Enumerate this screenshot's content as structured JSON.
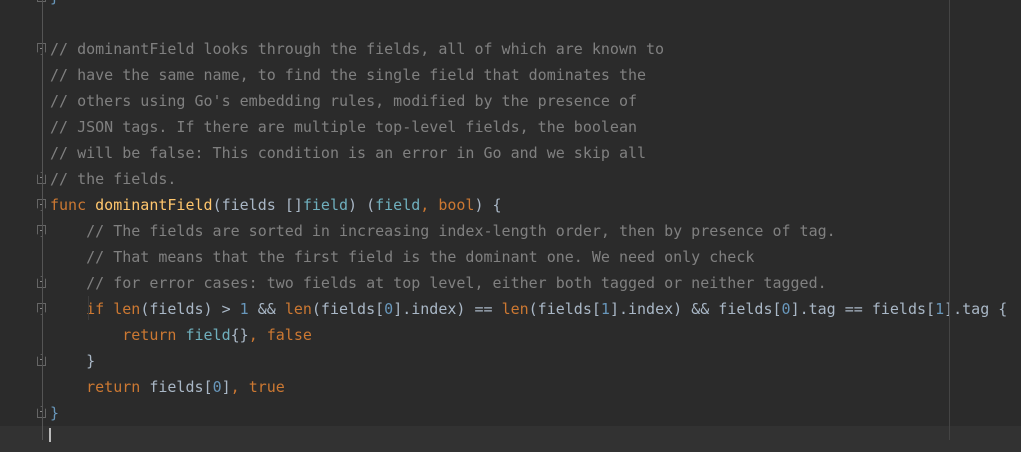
{
  "colors": {
    "background": "#2b2b2b",
    "comment": "#808080",
    "keyword": "#cc7832",
    "function": "#ffc66d",
    "type": "#6fafbd",
    "identifier": "#a9b7c6",
    "number": "#6897bb"
  },
  "lines": [
    {
      "fold": "end",
      "tokens": [
        [
          "}",
          "bb"
        ]
      ]
    },
    {
      "fold": "",
      "tokens": []
    },
    {
      "fold": "start",
      "tokens": [
        [
          "// dominantField looks through the fields, all of which are known to",
          "cm"
        ]
      ]
    },
    {
      "fold": "",
      "tokens": [
        [
          "// have the same name, to find the single field that dominates the",
          "cm"
        ]
      ]
    },
    {
      "fold": "",
      "tokens": [
        [
          "// others using Go's embedding rules, modified by the presence of",
          "cm"
        ]
      ]
    },
    {
      "fold": "",
      "tokens": [
        [
          "// JSON tags. If there are multiple top-level fields, the boolean",
          "cm"
        ]
      ]
    },
    {
      "fold": "",
      "tokens": [
        [
          "// will be false: This condition is an error in Go and we skip all",
          "cm"
        ]
      ]
    },
    {
      "fold": "end",
      "tokens": [
        [
          "// the fields.",
          "cm"
        ]
      ]
    },
    {
      "fold": "start",
      "tokens": [
        [
          "func ",
          "kw"
        ],
        [
          "dominantField",
          "fn"
        ],
        [
          "(fields ",
          "id"
        ],
        [
          "[]",
          "id"
        ],
        [
          "field",
          "ty"
        ],
        [
          ") (",
          "id"
        ],
        [
          "field",
          "ty"
        ],
        [
          ", ",
          "kw"
        ],
        [
          "bool",
          "kw"
        ],
        [
          ") {",
          "id"
        ]
      ]
    },
    {
      "fold": "start",
      "tokens": [
        [
          "    // The fields are sorted in increasing index-length order, then by presence of tag.",
          "cm"
        ]
      ]
    },
    {
      "fold": "",
      "tokens": [
        [
          "    // That means that the first field is the dominant one. We need only check",
          "cm"
        ]
      ]
    },
    {
      "fold": "end",
      "tokens": [
        [
          "    // for error cases: two fields at top level, either both tagged or neither tagged.",
          "cm"
        ]
      ]
    },
    {
      "fold": "start",
      "tokens": [
        [
          "    if ",
          "kw"
        ],
        [
          "len",
          "kw"
        ],
        [
          "(fields) > ",
          "id"
        ],
        [
          "1",
          "num"
        ],
        [
          " && ",
          "id"
        ],
        [
          "len",
          "kw"
        ],
        [
          "(fields[",
          "id"
        ],
        [
          "0",
          "num"
        ],
        [
          "].index) == ",
          "id"
        ],
        [
          "len",
          "kw"
        ],
        [
          "(fields[",
          "id"
        ],
        [
          "1",
          "num"
        ],
        [
          "].index) && fields[",
          "id"
        ],
        [
          "0",
          "num"
        ],
        [
          "].tag == fields[",
          "id"
        ],
        [
          "1",
          "num"
        ],
        [
          "].tag {",
          "id"
        ]
      ]
    },
    {
      "fold": "",
      "tokens": [
        [
          "        return ",
          "kw"
        ],
        [
          "field",
          "ty"
        ],
        [
          "{}",
          "id"
        ],
        [
          ", ",
          "kw"
        ],
        [
          "false",
          "kw"
        ]
      ]
    },
    {
      "fold": "end",
      "tokens": [
        [
          "    }",
          "id"
        ]
      ]
    },
    {
      "fold": "",
      "tokens": [
        [
          "    return ",
          "kw"
        ],
        [
          "fields[",
          "id"
        ],
        [
          "0",
          "num"
        ],
        [
          "]",
          "id"
        ],
        [
          ", ",
          "kw"
        ],
        [
          "true",
          "kw"
        ]
      ]
    },
    {
      "fold": "end",
      "tokens": [
        [
          "}",
          "bb"
        ]
      ]
    },
    {
      "fold": "",
      "current": true,
      "tokens": []
    }
  ]
}
